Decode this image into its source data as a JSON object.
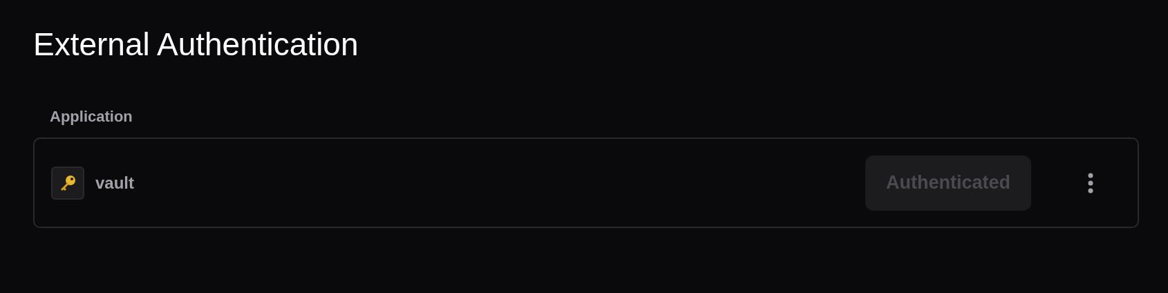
{
  "title": "External Authentication",
  "column_header": "Application",
  "applications": [
    {
      "name": "vault",
      "button": {
        "label": "Authenticated",
        "disabled": true
      }
    }
  ]
}
